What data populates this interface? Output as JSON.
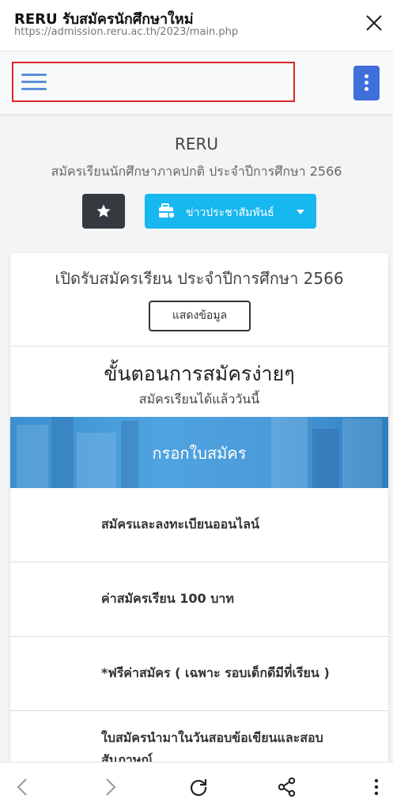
{
  "browser": {
    "title": "RERU รับสมัครนักศึกษาใหม่",
    "url": "https://admission.reru.ac.th/2023/main.php",
    "close_icon": "close-icon",
    "bottom_icons": [
      "back-icon",
      "forward-icon",
      "reload-icon",
      "share-icon",
      "more-vert-icon"
    ]
  },
  "navbar": {
    "menu_icon": "hamburger-menu-icon",
    "more_icon": "more-vert-icon",
    "highlight_color": "#e02424",
    "more_button_color": "#3f6fd8"
  },
  "header": {
    "site_name": "RERU",
    "subtitle": "สมัครเรียนนักศึกษาภาคปกติ ประจำปีการศึกษา 2566",
    "favorite_icon": "star-icon",
    "news_button": {
      "label": "ข่าวประชาสัมพันธ์",
      "icon": "briefcase-icon",
      "color": "#17b7ef"
    }
  },
  "card": {
    "title": "เปิดรับสมัครเรียน ประจำปีการศึกษา 2566",
    "show_button": "แสดงข้อมูล",
    "steps_title": "ขั้นตอนการสมัครง่ายๆ",
    "steps_subtitle": "สมัครเรียนได้แล้ววันนี้",
    "banner_label": "กรอกใบสมัคร",
    "steps": [
      "สมัครและลงทะเบียนออนไลน์",
      "ค่าสมัครเรียน 100 บาท",
      "*ฟรีค่าสมัคร ( เฉพาะ รอบเด็กดีมีที่เรียน )",
      "ใบสมัครนำมาในวันสอบข้อเขียนและสอบสัมภาษณ์"
    ]
  }
}
